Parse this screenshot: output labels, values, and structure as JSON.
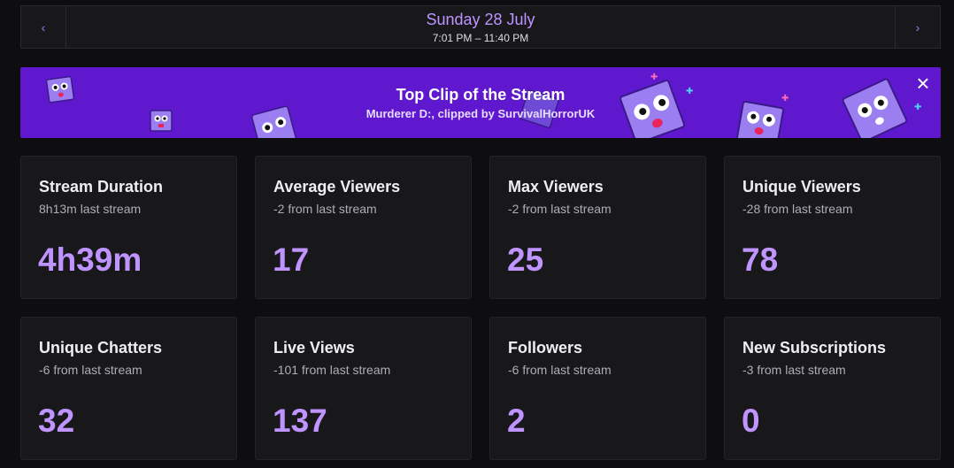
{
  "date_nav": {
    "prev_icon": "chevron-left-icon",
    "next_icon": "chevron-right-icon",
    "title": "Sunday 28 July",
    "time_range": "7:01 PM – 11:40 PM"
  },
  "banner": {
    "title": "Top Clip of the Stream",
    "subtitle": "Murderer D:, clipped by SurvivalHorrorUK",
    "close_icon": "close-icon",
    "background_color": "#6018cf"
  },
  "accent_color": "#bf94ff",
  "stats": [
    {
      "title": "Stream Duration",
      "sub": "8h13m last stream",
      "value": "4h39m"
    },
    {
      "title": "Average Viewers",
      "sub": "-2 from last stream",
      "value": "17"
    },
    {
      "title": "Max Viewers",
      "sub": "-2 from last stream",
      "value": "25"
    },
    {
      "title": "Unique Viewers",
      "sub": "-28 from last stream",
      "value": "78"
    },
    {
      "title": "Unique Chatters",
      "sub": "-6 from last stream",
      "value": "32"
    },
    {
      "title": "Live Views",
      "sub": "-101 from last stream",
      "value": "137"
    },
    {
      "title": "Followers",
      "sub": "-6 from last stream",
      "value": "2"
    },
    {
      "title": "New Subscriptions",
      "sub": "-3 from last stream",
      "value": "0"
    }
  ]
}
